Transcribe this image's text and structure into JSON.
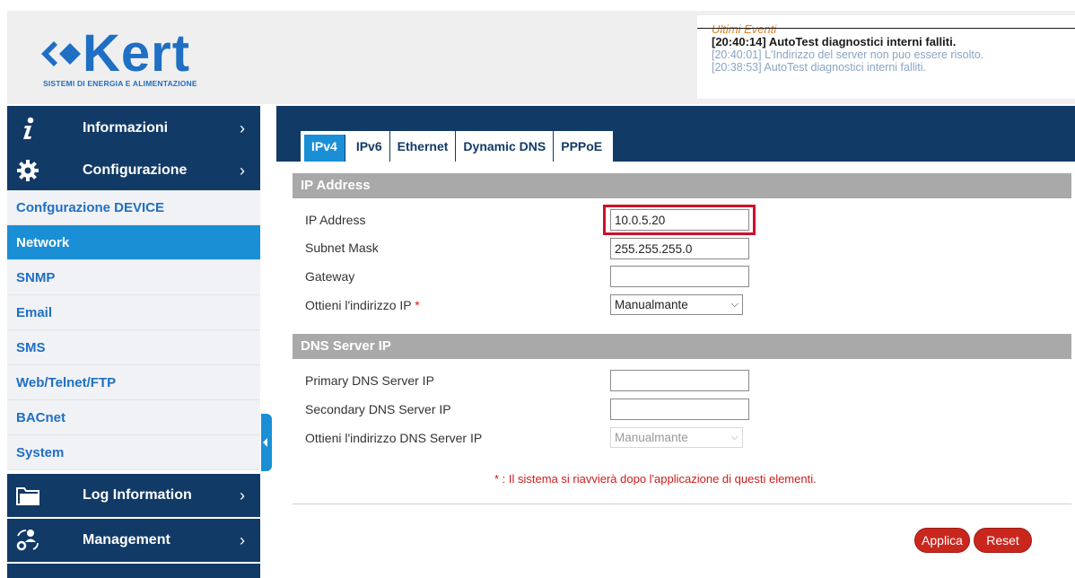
{
  "brand": {
    "name": "Kert",
    "tagline": "SISTEMI DI ENERGIA E ALIMENTAZIONE",
    "color": "#1f6fc4"
  },
  "events": {
    "title": "Ultimi Eventi",
    "items": [
      "[20:40:14] AutoTest diagnostici interni falliti.",
      "[20:40:01] L'Indirizzo del server non puo essere risolto.",
      "[20:38:53] AutoTest diagnostici interni falliti."
    ]
  },
  "sidebar": {
    "main": [
      {
        "label": "Informazioni",
        "icon": "info-icon"
      },
      {
        "label": "Configurazione",
        "icon": "gear-icon"
      },
      {
        "label": "Log Information",
        "icon": "folder-icon"
      },
      {
        "label": "Management",
        "icon": "user-gear-icon"
      }
    ],
    "sub": [
      {
        "label": "Confgurazione DEVICE"
      },
      {
        "label": "Network"
      },
      {
        "label": "SNMP"
      },
      {
        "label": "Email"
      },
      {
        "label": "SMS"
      },
      {
        "label": "Web/Telnet/FTP"
      },
      {
        "label": "BACnet"
      },
      {
        "label": "System"
      }
    ],
    "active": "Network"
  },
  "tabs": [
    "IPv4",
    "IPv6",
    "Ethernet",
    "Dynamic DNS",
    "PPPoE"
  ],
  "active_tab": "IPv4",
  "ip_section": {
    "title": "IP Address",
    "ip_label": "IP Address",
    "ip_value": "10.0.5.20",
    "mask_label": "Subnet Mask",
    "mask_value": "255.255.255.0",
    "gateway_label": "Gateway",
    "gateway_value": "",
    "obtain_label": "Ottieni l'indirizzo IP",
    "obtain_value": "Manualmante"
  },
  "dns_section": {
    "title": "DNS Server IP",
    "primary_label": "Primary DNS Server IP",
    "primary_value": "",
    "secondary_label": "Secondary DNS Server IP",
    "secondary_value": "",
    "obtain_label": "Ottieni l'indirizzo DNS Server IP",
    "obtain_value": "Manualmante"
  },
  "required_mark": "*",
  "note": "* : Il sistema si riavvierà dopo l'applicazione di questi elementi.",
  "buttons": {
    "apply": "Applica",
    "reset": "Reset"
  },
  "colors": {
    "nav_dark": "#123a66",
    "accent": "#1a8fd6",
    "section": "#a9a9a9",
    "button": "#c9271e",
    "highlight": "#d0102a"
  }
}
